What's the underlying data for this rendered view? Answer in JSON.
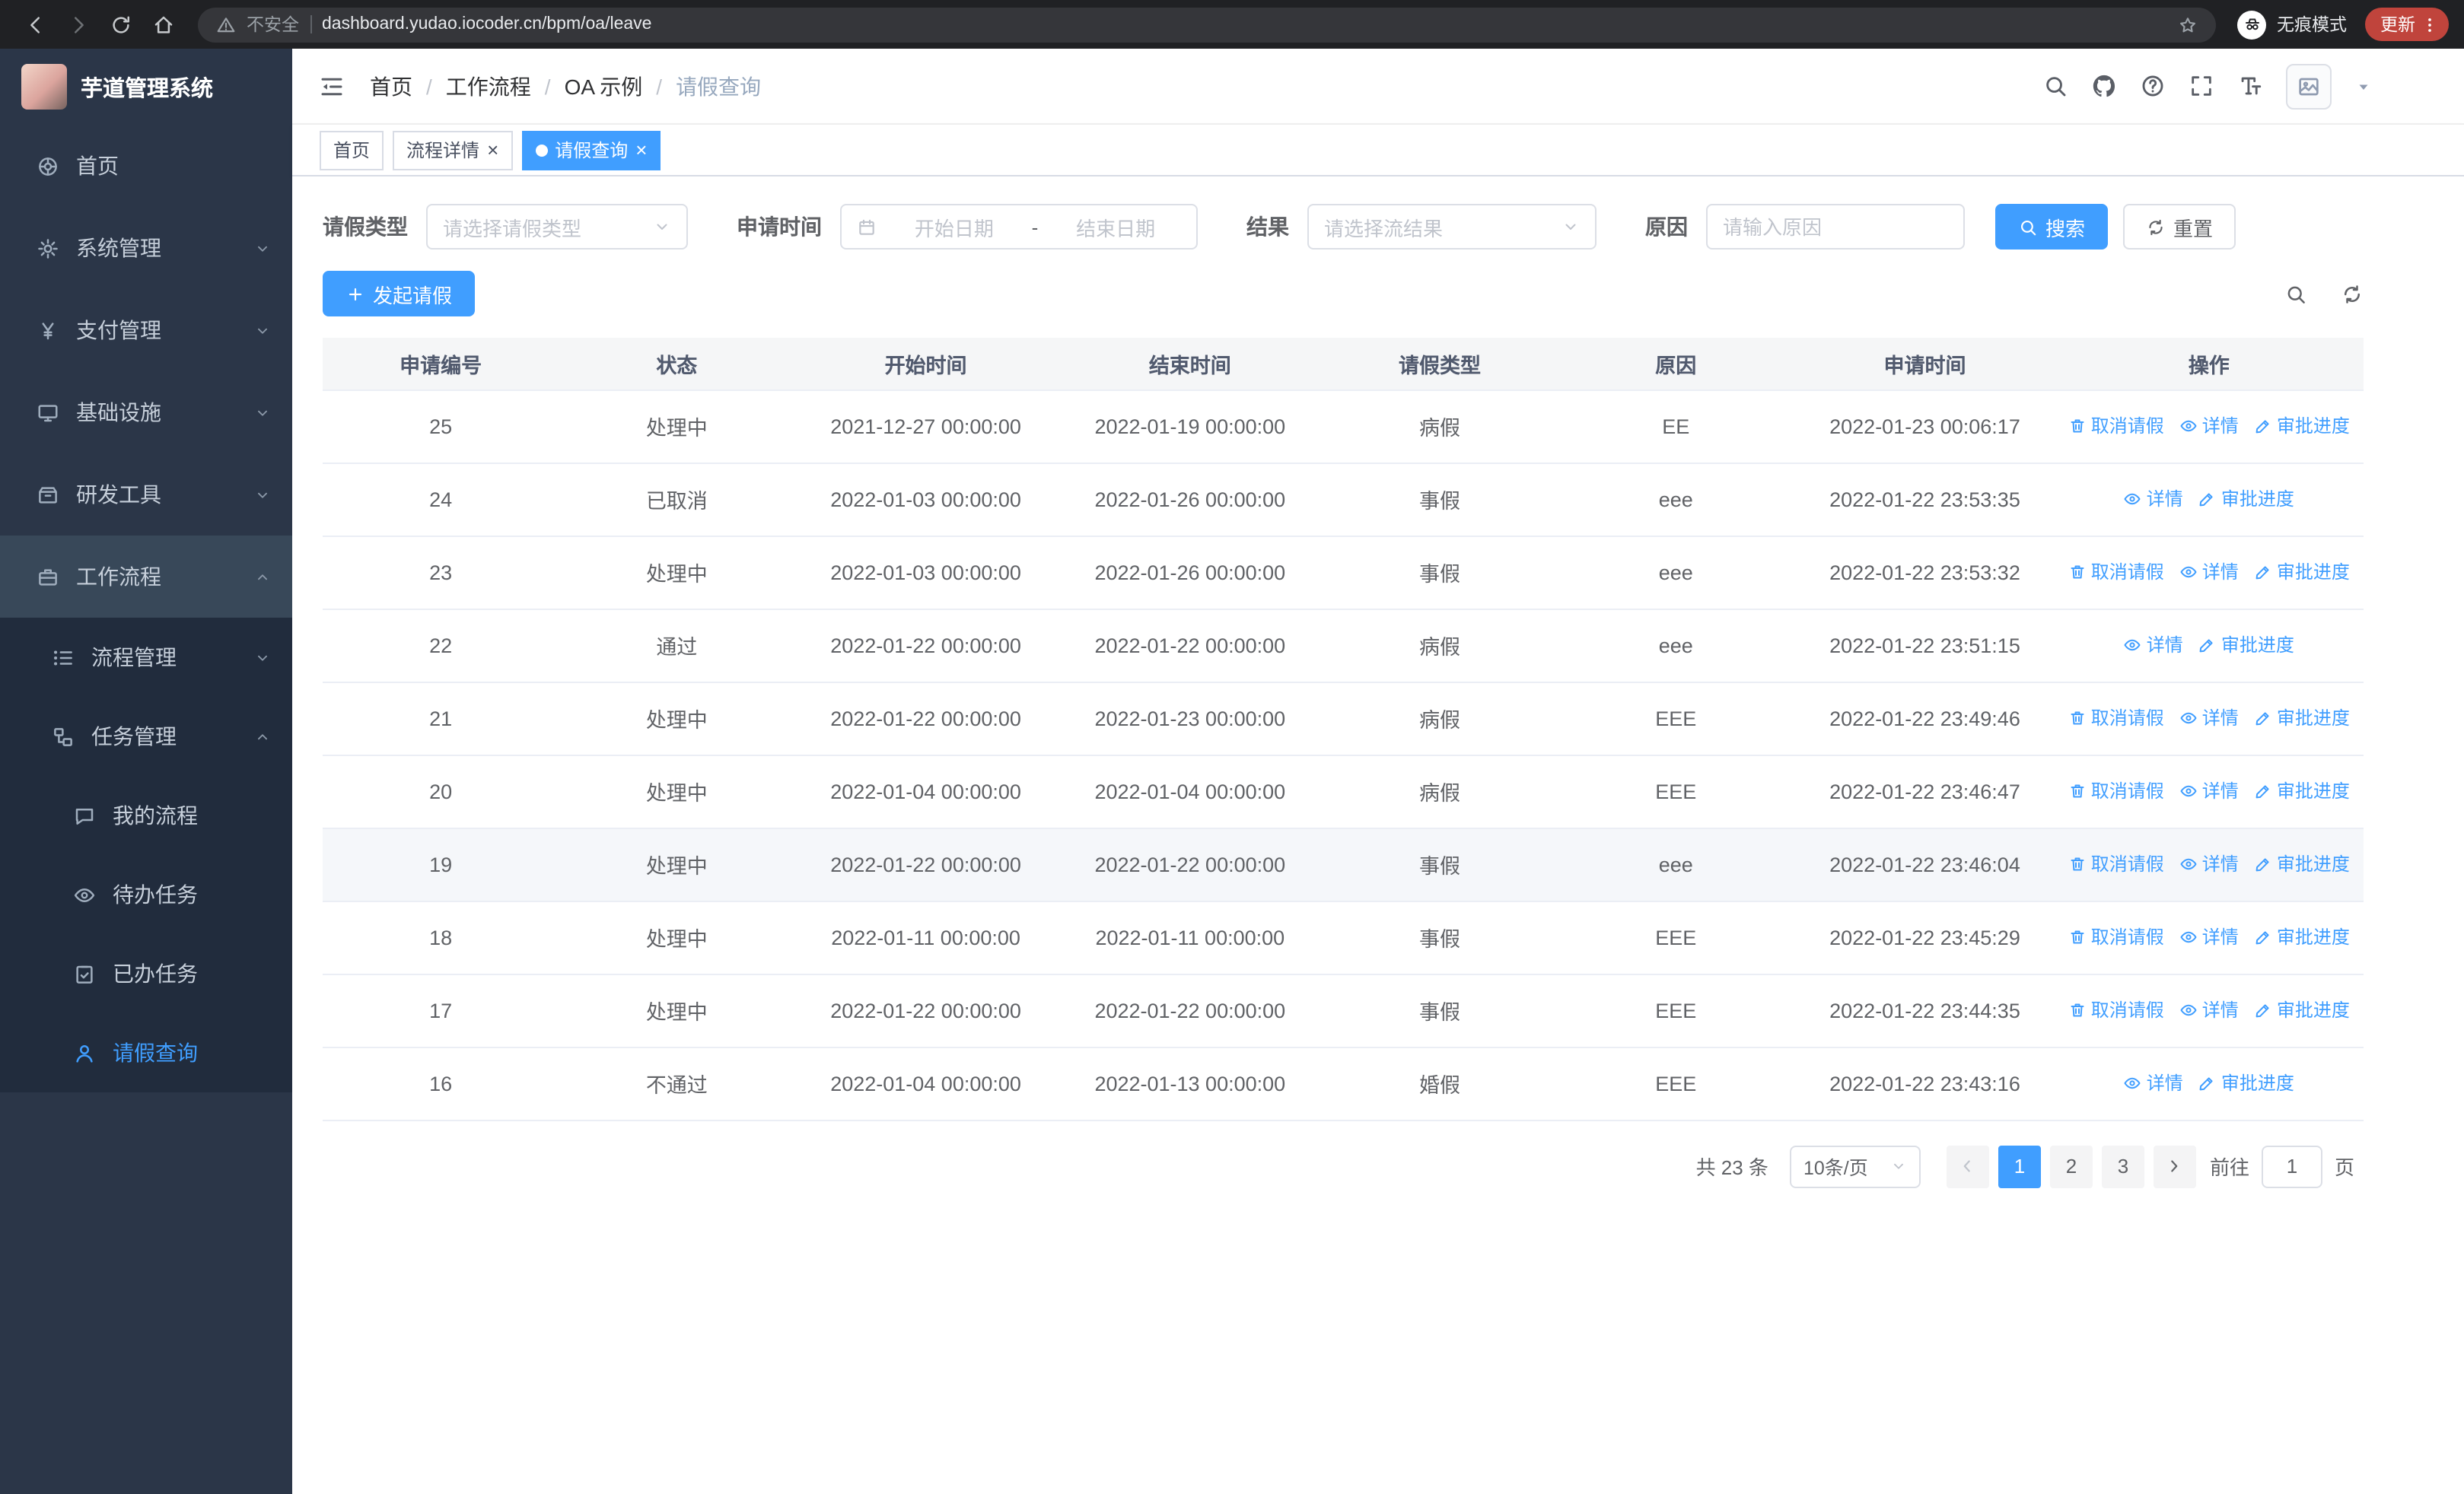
{
  "colors": {
    "primary": "#409eff",
    "sidebar_bg": "#2b3648",
    "submenu_bg": "#212c3d",
    "open_parent_bg": "#384859",
    "table_header_bg": "#f5f6f7",
    "update_red": "#c0443c"
  },
  "browser": {
    "security_warning": "不安全",
    "url": "dashboard.yudao.iocoder.cn/bpm/oa/leave",
    "incognito_label": "无痕模式",
    "update_button": "更新"
  },
  "sidebar": {
    "app_title": "芋道管理系统",
    "items": [
      {
        "key": "home",
        "label": "首页",
        "icon": "dashboard-icon",
        "level": 1
      },
      {
        "key": "system",
        "label": "系统管理",
        "icon": "gear-icon",
        "level": 1,
        "chevron": "down"
      },
      {
        "key": "payment",
        "label": "支付管理",
        "icon": "yen-icon",
        "level": 1,
        "chevron": "down"
      },
      {
        "key": "infrastructure",
        "label": "基础设施",
        "icon": "infra-icon",
        "level": 1,
        "chevron": "down"
      },
      {
        "key": "dev-tools",
        "label": "研发工具",
        "icon": "tools-icon",
        "level": 1,
        "chevron": "down"
      },
      {
        "key": "workflow",
        "label": "工作流程",
        "icon": "workflow-icon",
        "level": 1,
        "chevron": "up",
        "expanded": true
      },
      {
        "key": "process-management",
        "label": "流程管理",
        "icon": "process-icon",
        "level": 2,
        "chevron": "down"
      },
      {
        "key": "task-management",
        "label": "任务管理",
        "icon": "task-icon",
        "level": 2,
        "chevron": "up",
        "expanded": true
      },
      {
        "key": "my-process",
        "label": "我的流程",
        "icon": "chat-icon",
        "level": 3
      },
      {
        "key": "todo-tasks",
        "label": "待办任务",
        "icon": "eye-icon",
        "level": 3
      },
      {
        "key": "done-tasks",
        "label": "已办任务",
        "icon": "done-icon",
        "level": 3
      },
      {
        "key": "leave-query",
        "label": "请假查询",
        "icon": "user-icon",
        "level": 3,
        "active": true
      }
    ]
  },
  "header": {
    "breadcrumb": [
      "首页",
      "工作流程",
      "OA 示例",
      "请假查询"
    ]
  },
  "tabs": [
    {
      "key": "home",
      "label": "首页",
      "closable": false,
      "active": false
    },
    {
      "key": "process-detail",
      "label": "流程详情",
      "closable": true,
      "active": false
    },
    {
      "key": "leave-query",
      "label": "请假查询",
      "closable": true,
      "active": true
    }
  ],
  "filters": {
    "leave_type_label": "请假类型",
    "leave_type_placeholder": "请选择请假类型",
    "apply_time_label": "申请时间",
    "start_date_placeholder": "开始日期",
    "date_separator": "-",
    "end_date_placeholder": "结束日期",
    "result_label": "结果",
    "result_placeholder": "请选择流结果",
    "reason_label": "原因",
    "reason_placeholder": "请输入原因",
    "search_button": "搜索",
    "reset_button": "重置"
  },
  "toolbar": {
    "create_button": "发起请假"
  },
  "table": {
    "columns": [
      "申请编号",
      "状态",
      "开始时间",
      "结束时间",
      "请假类型",
      "原因",
      "申请时间",
      "操作"
    ],
    "action_labels": {
      "cancel": "取消请假",
      "detail": "详情",
      "progress": "审批进度"
    },
    "rows": [
      {
        "id": "25",
        "status": "处理中",
        "start": "2021-12-27 00:00:00",
        "end": "2022-01-19 00:00:00",
        "type": "病假",
        "reason": "EE",
        "applied": "2022-01-23 00:06:17",
        "actions": [
          "cancel",
          "detail",
          "progress"
        ]
      },
      {
        "id": "24",
        "status": "已取消",
        "start": "2022-01-03 00:00:00",
        "end": "2022-01-26 00:00:00",
        "type": "事假",
        "reason": "eee",
        "applied": "2022-01-22 23:53:35",
        "actions": [
          "detail",
          "progress"
        ]
      },
      {
        "id": "23",
        "status": "处理中",
        "start": "2022-01-03 00:00:00",
        "end": "2022-01-26 00:00:00",
        "type": "事假",
        "reason": "eee",
        "applied": "2022-01-22 23:53:32",
        "actions": [
          "cancel",
          "detail",
          "progress"
        ]
      },
      {
        "id": "22",
        "status": "通过",
        "start": "2022-01-22 00:00:00",
        "end": "2022-01-22 00:00:00",
        "type": "病假",
        "reason": "eee",
        "applied": "2022-01-22 23:51:15",
        "actions": [
          "detail",
          "progress"
        ]
      },
      {
        "id": "21",
        "status": "处理中",
        "start": "2022-01-22 00:00:00",
        "end": "2022-01-23 00:00:00",
        "type": "病假",
        "reason": "EEE",
        "applied": "2022-01-22 23:49:46",
        "actions": [
          "cancel",
          "detail",
          "progress"
        ]
      },
      {
        "id": "20",
        "status": "处理中",
        "start": "2022-01-04 00:00:00",
        "end": "2022-01-04 00:00:00",
        "type": "病假",
        "reason": "EEE",
        "applied": "2022-01-22 23:46:47",
        "actions": [
          "cancel",
          "detail",
          "progress"
        ]
      },
      {
        "id": "19",
        "status": "处理中",
        "start": "2022-01-22 00:00:00",
        "end": "2022-01-22 00:00:00",
        "type": "事假",
        "reason": "eee",
        "applied": "2022-01-22 23:46:04",
        "actions": [
          "cancel",
          "detail",
          "progress"
        ],
        "highlighted": true
      },
      {
        "id": "18",
        "status": "处理中",
        "start": "2022-01-11 00:00:00",
        "end": "2022-01-11 00:00:00",
        "type": "事假",
        "reason": "EEE",
        "applied": "2022-01-22 23:45:29",
        "actions": [
          "cancel",
          "detail",
          "progress"
        ]
      },
      {
        "id": "17",
        "status": "处理中",
        "start": "2022-01-22 00:00:00",
        "end": "2022-01-22 00:00:00",
        "type": "事假",
        "reason": "EEE",
        "applied": "2022-01-22 23:44:35",
        "actions": [
          "cancel",
          "detail",
          "progress"
        ]
      },
      {
        "id": "16",
        "status": "不通过",
        "start": "2022-01-04 00:00:00",
        "end": "2022-01-13 00:00:00",
        "type": "婚假",
        "reason": "EEE",
        "applied": "2022-01-22 23:43:16",
        "actions": [
          "detail",
          "progress"
        ]
      }
    ]
  },
  "pagination": {
    "total_text": "共 23 条",
    "page_size": "10条/页",
    "pages": [
      "1",
      "2",
      "3"
    ],
    "active_page": "1",
    "goto_prefix": "前往",
    "goto_value": "1",
    "goto_suffix": "页"
  }
}
